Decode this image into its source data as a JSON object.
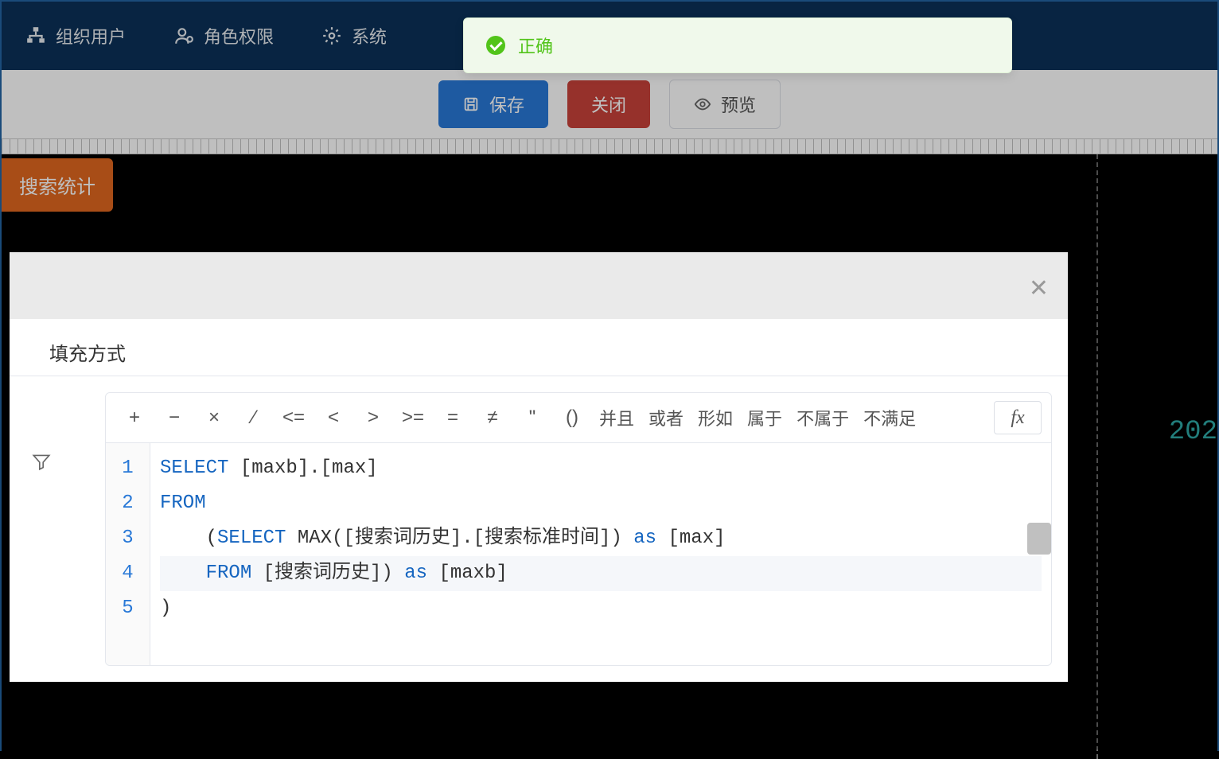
{
  "topnav": {
    "items": [
      {
        "label": "组织用户",
        "icon": "org"
      },
      {
        "label": "角色权限",
        "icon": "role"
      },
      {
        "label": "系统",
        "icon": "gear",
        "truncated": true
      }
    ]
  },
  "toast": {
    "text": "正确"
  },
  "actions": {
    "save": "保存",
    "close": "关闭",
    "preview": "预览"
  },
  "canvas": {
    "tab_label": "搜索统计",
    "date_partial": "202"
  },
  "modal": {
    "tab_label": "填充方式",
    "operators": {
      "plus": "+",
      "minus": "−",
      "times": "×",
      "divide": "∕",
      "lte": "<=",
      "lt": "<",
      "gt": ">",
      "gte": ">=",
      "eq": "=",
      "neq": "≠",
      "quote": "\"",
      "paren": "()",
      "and": "并且",
      "or": "或者",
      "like": "形如",
      "in": "属于",
      "notin": "不属于",
      "not": "不满足",
      "fx": "fx"
    },
    "code": {
      "line_numbers": [
        "1",
        "2",
        "3",
        "4",
        "5"
      ],
      "lines": [
        {
          "tokens": [
            {
              "t": "SELECT",
              "c": "kw"
            },
            {
              "t": " [maxb].[max]"
            }
          ]
        },
        {
          "tokens": [
            {
              "t": "FROM",
              "c": "kw"
            }
          ]
        },
        {
          "tokens": [
            {
              "t": "    ("
            },
            {
              "t": "SELECT",
              "c": "kw"
            },
            {
              "t": " MAX([搜索词历史].[搜索标准时间]) "
            },
            {
              "t": "as",
              "c": "kw"
            },
            {
              "t": " [max]"
            }
          ]
        },
        {
          "tokens": [
            {
              "t": "    "
            },
            {
              "t": "FROM",
              "c": "kw"
            },
            {
              "t": " [搜索词历史]) "
            },
            {
              "t": "as",
              "c": "kw"
            },
            {
              "t": " [maxb]"
            }
          ],
          "active": true
        },
        {
          "tokens": [
            {
              "t": ")"
            }
          ]
        }
      ]
    }
  }
}
